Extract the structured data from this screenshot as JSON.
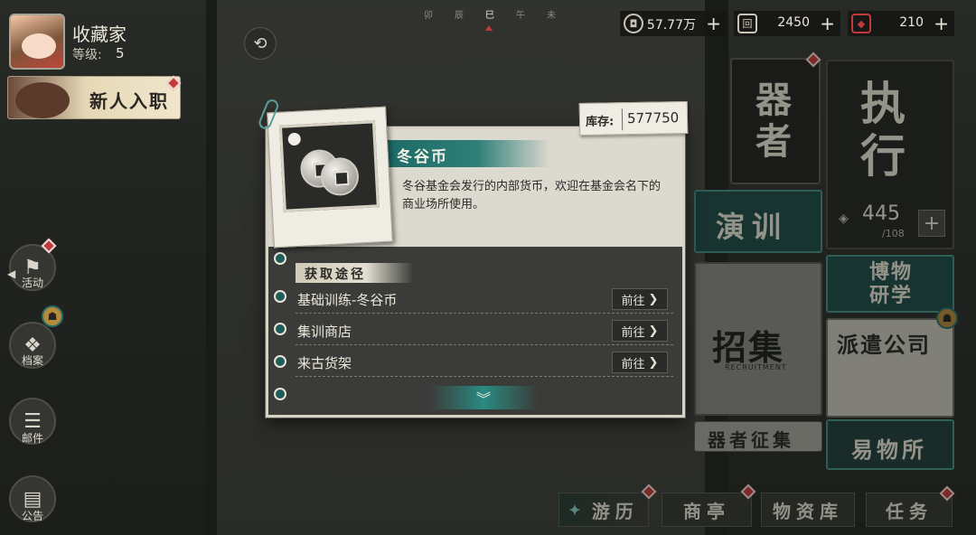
{
  "player": {
    "name": "收藏家",
    "level_label": "等级:",
    "level": "5"
  },
  "event_banner": {
    "text": "新人入职"
  },
  "time_strip": {
    "hours": [
      "卯",
      "辰",
      "巳",
      "午",
      "未"
    ],
    "current": "巳"
  },
  "resources": [
    {
      "icon": "coin-icon",
      "value": "57.77万"
    },
    {
      "icon": "ticket-icon",
      "value": "2450"
    },
    {
      "icon": "gem-icon",
      "value": "210"
    }
  ],
  "side_menu": [
    {
      "label": "活动",
      "icon": "activity-icon"
    },
    {
      "label": "档案",
      "icon": "archive-icon"
    },
    {
      "label": "邮件",
      "icon": "mail-icon"
    },
    {
      "label": "公告",
      "icon": "notice-icon"
    }
  ],
  "cards": {
    "ready": "器者",
    "execute": "执行",
    "execute_count": "445",
    "execute_max": "/108",
    "drill": "演训",
    "museum": "博物研学",
    "recruit": "招集",
    "recruit_sub": "RECRUITMENT",
    "dispatch": "派遣公司",
    "collect": "器者征集",
    "trade": "易物所"
  },
  "bottom_nav": [
    "游历",
    "商亭",
    "物资库",
    "任务"
  ],
  "modal": {
    "inventory_label": "库存:",
    "inventory_value": "577750",
    "item_name": "冬谷币",
    "description": "冬谷基金会发行的内部货币，欢迎在基金会名下的商业场所使用。",
    "sources_title": "获取途径",
    "sources": [
      {
        "name": "基础训练-冬谷币",
        "action": "前往"
      },
      {
        "name": "集训商店",
        "action": "前往"
      },
      {
        "name": "来古货架",
        "action": "前往"
      }
    ],
    "more_icon": "chevron-double-down-icon"
  },
  "colors": {
    "accent_teal": "#1d6a66",
    "alert_red": "#c23b3b",
    "panel_dark": "#3b3c39",
    "paper": "#dcd9cf"
  }
}
